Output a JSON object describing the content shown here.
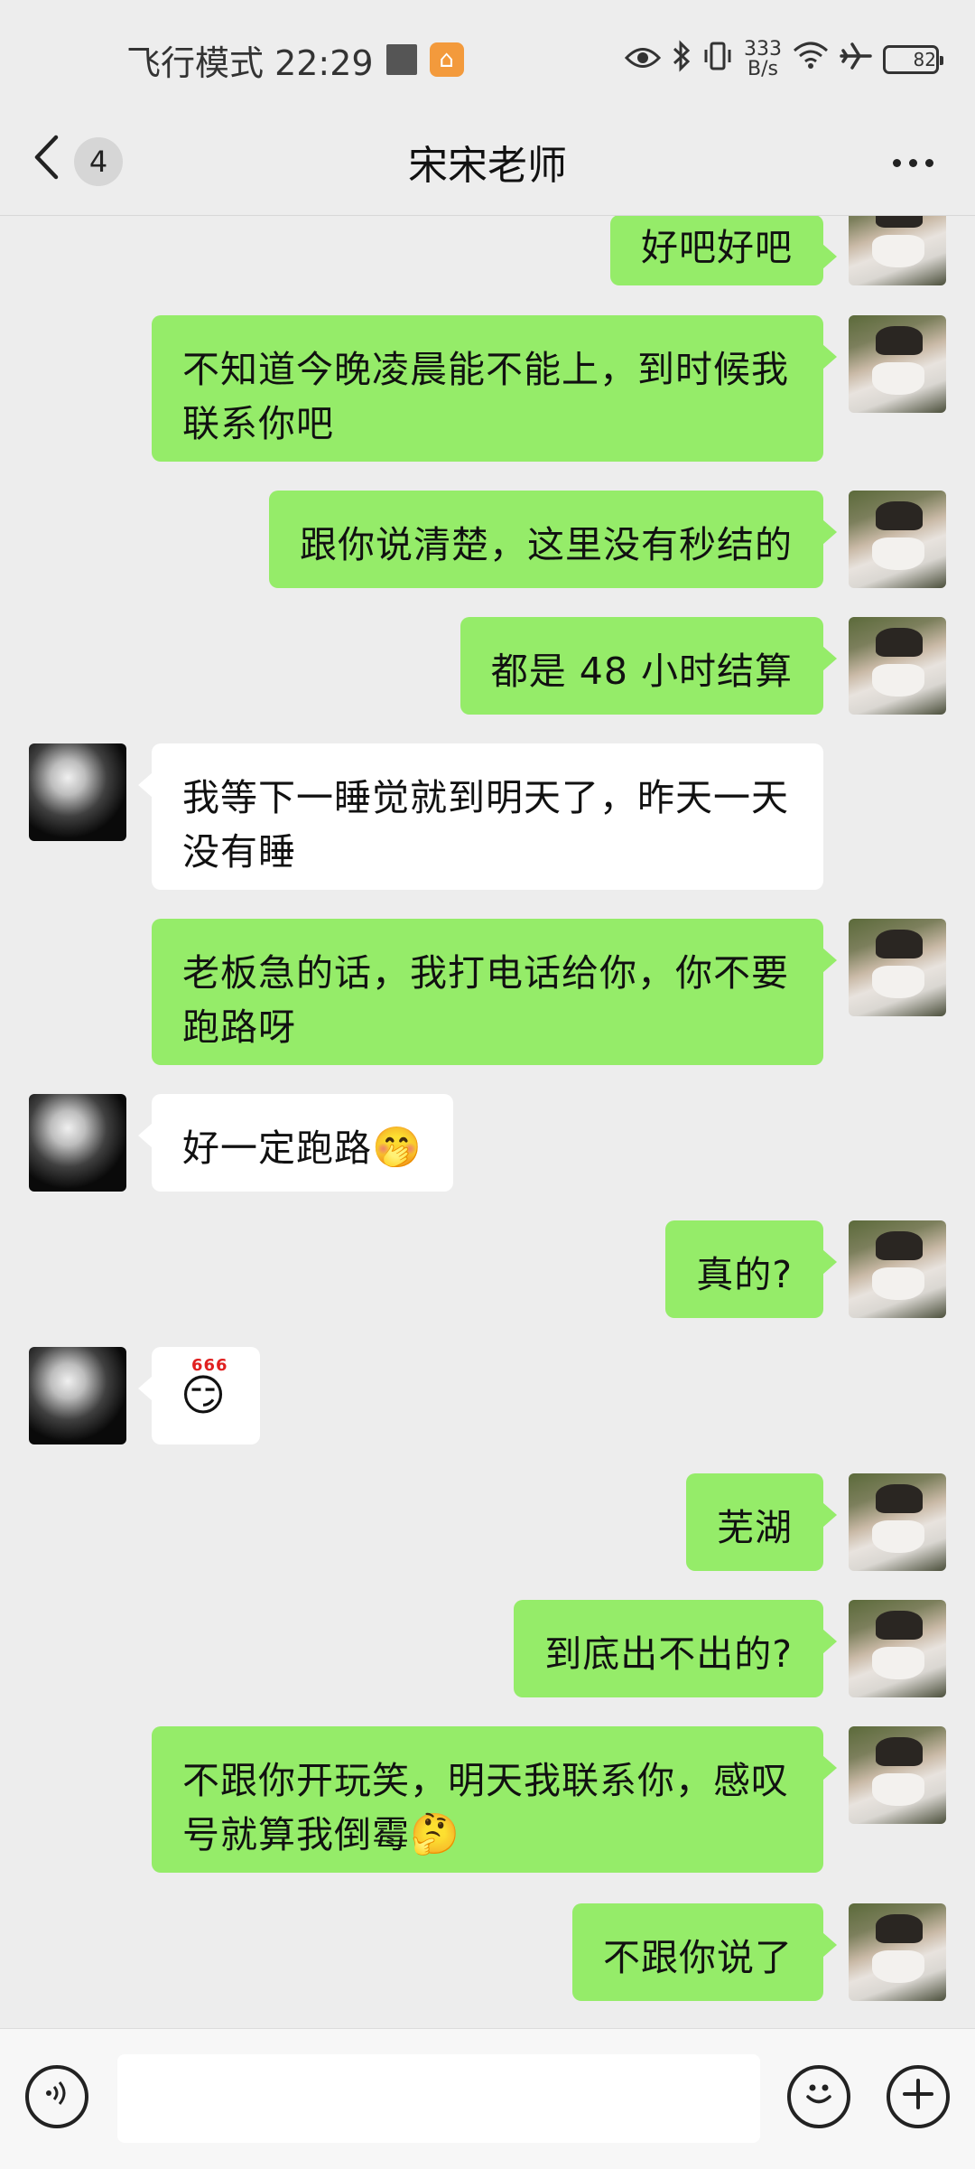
{
  "status_bar": {
    "mode_time": "飞行模式 22:29",
    "net_speed_value": "333",
    "net_speed_unit": "B/s",
    "battery": "82",
    "battery_level": 0.82
  },
  "header": {
    "unread_count": "4",
    "title": "宋宋老师"
  },
  "messages": [
    {
      "from": "me",
      "text": "好吧好吧"
    },
    {
      "from": "me",
      "text": "不知道今晚凌晨能不能上，到时候我联系你吧"
    },
    {
      "from": "me",
      "text": "跟你说清楚，这里没有秒结的"
    },
    {
      "from": "me",
      "text": "都是 48 小时结算"
    },
    {
      "from": "other",
      "text": "我等下一睡觉就到明天了，昨天一天没有睡"
    },
    {
      "from": "me",
      "text": "老板急的话，我打电话给你，你不要跑路呀"
    },
    {
      "from": "other",
      "text": "好一定跑路",
      "emoji": "🤭"
    },
    {
      "from": "me",
      "text": "真的?"
    },
    {
      "from": "other",
      "sticker": "666",
      "sticker_face": "😏"
    },
    {
      "from": "me",
      "text": "芜湖"
    },
    {
      "from": "me",
      "text": "到底出不出的?"
    },
    {
      "from": "me",
      "text": "不跟你开玩笑，明天我联系你，感叹号就算我倒霉",
      "emoji": "🤔"
    },
    {
      "from": "me",
      "text": "不跟你说了"
    }
  ],
  "input": {
    "placeholder": "",
    "value": ""
  },
  "icons": {
    "voice": "voice-icon",
    "emoji": "emoji-icon",
    "plus": "plus-icon"
  }
}
